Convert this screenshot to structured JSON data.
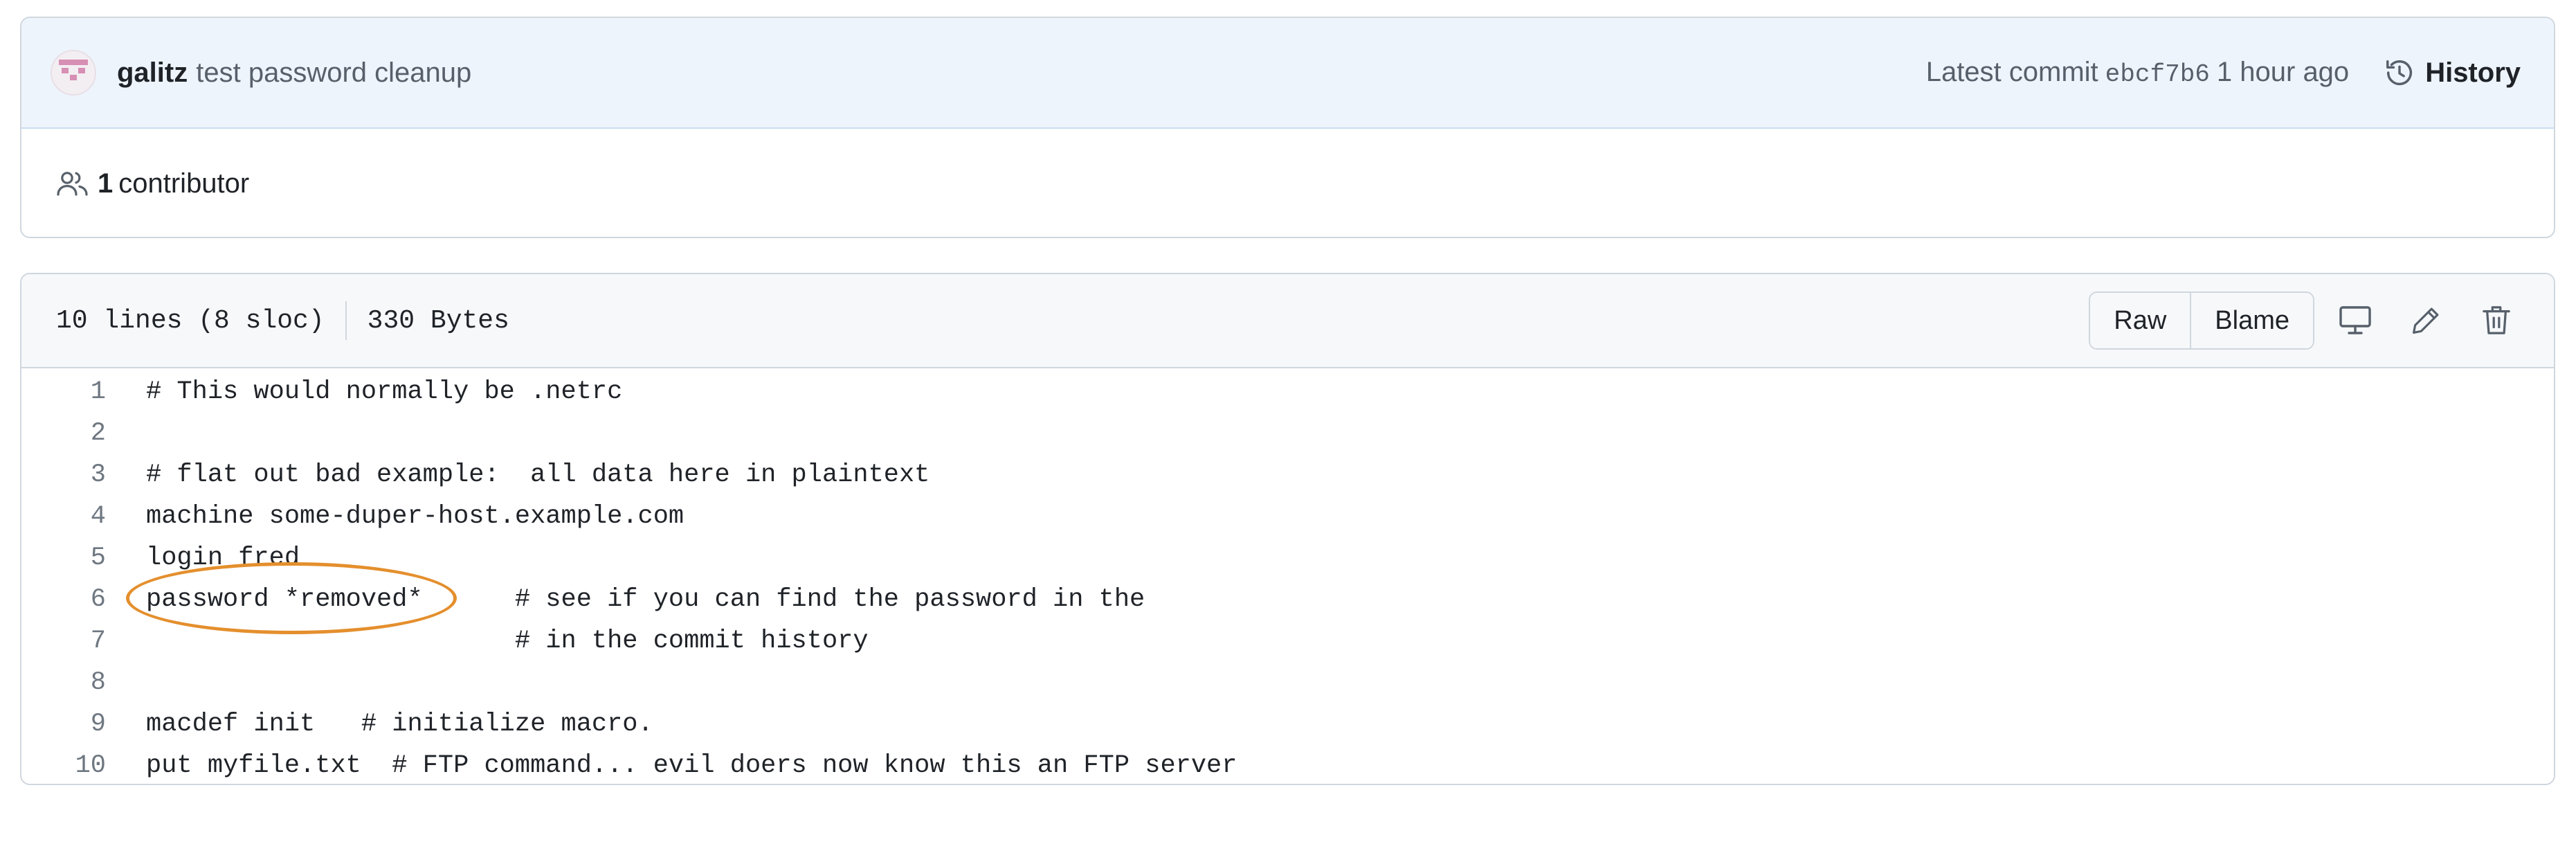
{
  "commit": {
    "author": "galitz",
    "message": "test password cleanup",
    "latest_label": "Latest commit",
    "sha": "ebcf7b6",
    "time": "1 hour ago",
    "history_label": "History"
  },
  "contributors": {
    "count": "1",
    "label": "contributor"
  },
  "file": {
    "lines_info": "10 lines (8 sloc)",
    "size": "330 Bytes",
    "raw_label": "Raw",
    "blame_label": "Blame",
    "lines": [
      {
        "num": "1",
        "text": "# This would normally be .netrc"
      },
      {
        "num": "2",
        "text": ""
      },
      {
        "num": "3",
        "text": "# flat out bad example:  all data here in plaintext"
      },
      {
        "num": "4",
        "text": "machine some-duper-host.example.com"
      },
      {
        "num": "5",
        "text": "login fred"
      },
      {
        "num": "6",
        "text": "password *removed*      # see if you can find the password in the"
      },
      {
        "num": "7",
        "text": "                        # in the commit history"
      },
      {
        "num": "8",
        "text": ""
      },
      {
        "num": "9",
        "text": "macdef init   # initialize macro."
      },
      {
        "num": "10",
        "text": "put myfile.txt  # FTP command... evil doers now know this an FTP server"
      }
    ]
  },
  "icons": {
    "avatar": "identicon-avatar",
    "history": "history-clock-icon",
    "people": "people-icon",
    "desktop": "desktop-icon",
    "edit": "pencil-icon",
    "delete": "trash-icon"
  },
  "colors": {
    "annotation": "#e48f2d",
    "header_bg": "#eef4fc"
  }
}
